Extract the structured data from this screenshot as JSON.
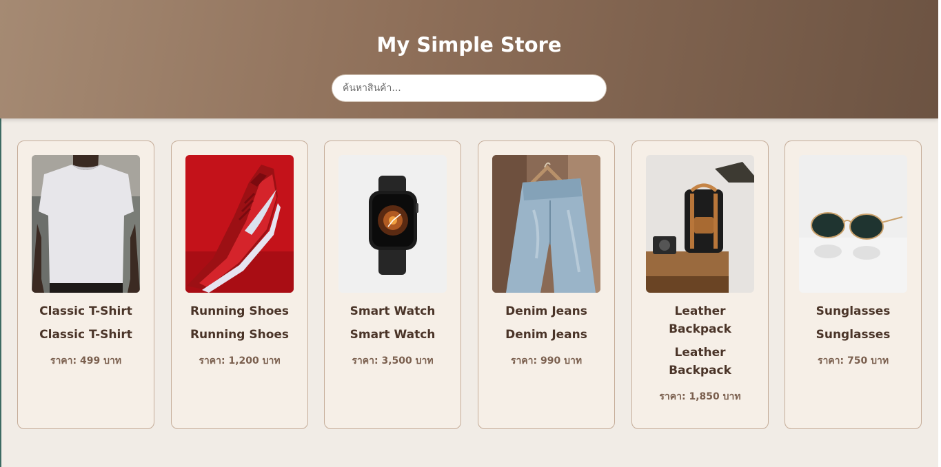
{
  "header": {
    "title": "My Simple Store",
    "search_placeholder": "ค้นหาสินค้า..."
  },
  "products": [
    {
      "name": "Classic T-Shirt",
      "subtitle": "Classic T-Shirt",
      "price": "ราคา: 499 บาท",
      "image": "tshirt-photo"
    },
    {
      "name": "Running Shoes",
      "subtitle": "Running Shoes",
      "price": "ราคา: 1,200 บาท",
      "image": "shoe-photo"
    },
    {
      "name": "Smart Watch",
      "subtitle": "Smart Watch",
      "price": "ราคา: 3,500 บาท",
      "image": "watch-photo"
    },
    {
      "name": "Denim Jeans",
      "subtitle": "Denim Jeans",
      "price": "ราคา: 990 บาท",
      "image": "jeans-photo"
    },
    {
      "name": "Leather Backpack",
      "subtitle": "Leather Backpack",
      "price": "ราคา: 1,850 บาท",
      "image": "backpack-photo"
    },
    {
      "name": "Sunglasses",
      "subtitle": "Sunglasses",
      "price": "ราคา: 750 บาท",
      "image": "sunglasses-photo"
    }
  ],
  "colors": {
    "header_start": "#a58a73",
    "header_end": "#6c5342",
    "card_bg": "#f6efe7",
    "card_border": "#c4ab97",
    "name_text": "#4a3428",
    "price_text": "#7a5f4e",
    "page_bg": "#f1ece6"
  }
}
